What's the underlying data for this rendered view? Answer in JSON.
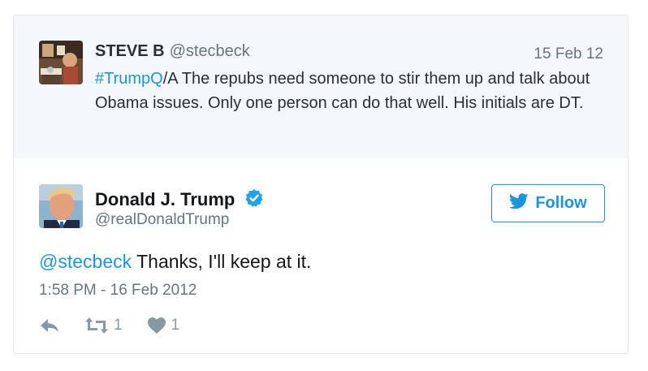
{
  "quoted_tweet": {
    "author_name": "STEVE B",
    "author_handle": "@stecbeck",
    "date": "15 Feb 12",
    "hashtag": "#TrumpQ",
    "text_after_hashtag": "/A The repubs need someone to stir them up and talk about Obama issues. Only one person can do that well. His initials are DT."
  },
  "main_tweet": {
    "author_name": "Donald J. Trump",
    "author_handle": "@realDonaldTrump",
    "follow_label": "Follow",
    "mention": "@stecbeck",
    "text_after_mention": " Thanks, I'll keep at it.",
    "timestamp": "1:58 PM - 16 Feb 2012",
    "retweet_count": "1",
    "like_count": "1"
  },
  "colors": {
    "link": "#1b95e0",
    "muted": "#66757f",
    "quoted_bg": "#f5f8fa",
    "verified": "#1da1f2"
  },
  "icons": [
    "reply-icon",
    "retweet-icon",
    "heart-icon",
    "twitter-bird-icon",
    "verified-badge-icon"
  ]
}
